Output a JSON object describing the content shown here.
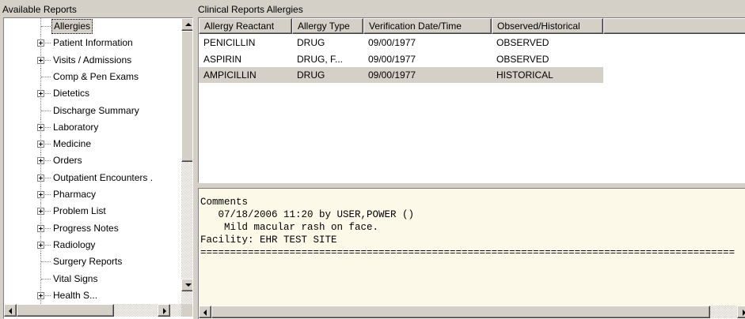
{
  "left_panel": {
    "title": "Available Reports",
    "tree": [
      {
        "label": "Allergies",
        "expandable": false,
        "selected": true
      },
      {
        "label": "Patient Information",
        "expandable": true
      },
      {
        "label": "Visits / Admissions",
        "expandable": true
      },
      {
        "label": "Comp & Pen Exams",
        "expandable": false
      },
      {
        "label": "Dietetics",
        "expandable": true
      },
      {
        "label": "Discharge Summary",
        "expandable": false
      },
      {
        "label": "Laboratory",
        "expandable": true
      },
      {
        "label": "Medicine",
        "expandable": true
      },
      {
        "label": "Orders",
        "expandable": true
      },
      {
        "label": "Outpatient Encounters .",
        "expandable": true
      },
      {
        "label": "Pharmacy",
        "expandable": true
      },
      {
        "label": "Problem List",
        "expandable": true
      },
      {
        "label": "Progress Notes",
        "expandable": true
      },
      {
        "label": "Radiology",
        "expandable": true
      },
      {
        "label": "Surgery Reports",
        "expandable": false
      },
      {
        "label": "Vital Signs",
        "expandable": false
      },
      {
        "label": "Health S...",
        "expandable": true
      }
    ]
  },
  "right_panel": {
    "title": "Clinical Reports Allergies",
    "columns": [
      "Allergy Reactant",
      "Allergy Type",
      "Verification Date/Time",
      "Observed/Historical"
    ],
    "rows": [
      {
        "cells": [
          "PENICILLIN",
          "DRUG",
          "09/00/1977",
          "OBSERVED"
        ],
        "selected": false
      },
      {
        "cells": [
          "ASPIRIN",
          "DRUG, F...",
          "09/00/1977",
          "OBSERVED"
        ],
        "selected": false
      },
      {
        "cells": [
          "AMPICILLIN",
          "DRUG",
          "09/00/1977",
          "HISTORICAL"
        ],
        "selected": true
      }
    ],
    "comments": {
      "heading": "Comments",
      "line1": "   07/18/2006 11:20 by USER,POWER ()",
      "line2": "    Mild macular rash on face.",
      "facility": "Facility: EHR TEST SITE",
      "separator": "=========================================================================================="
    }
  },
  "icons": {
    "expand": "plus-box-icon",
    "scroll_up": "arrow-up-icon",
    "scroll_down": "arrow-down-icon",
    "scroll_left": "arrow-left-icon",
    "scroll_right": "arrow-right-icon"
  }
}
